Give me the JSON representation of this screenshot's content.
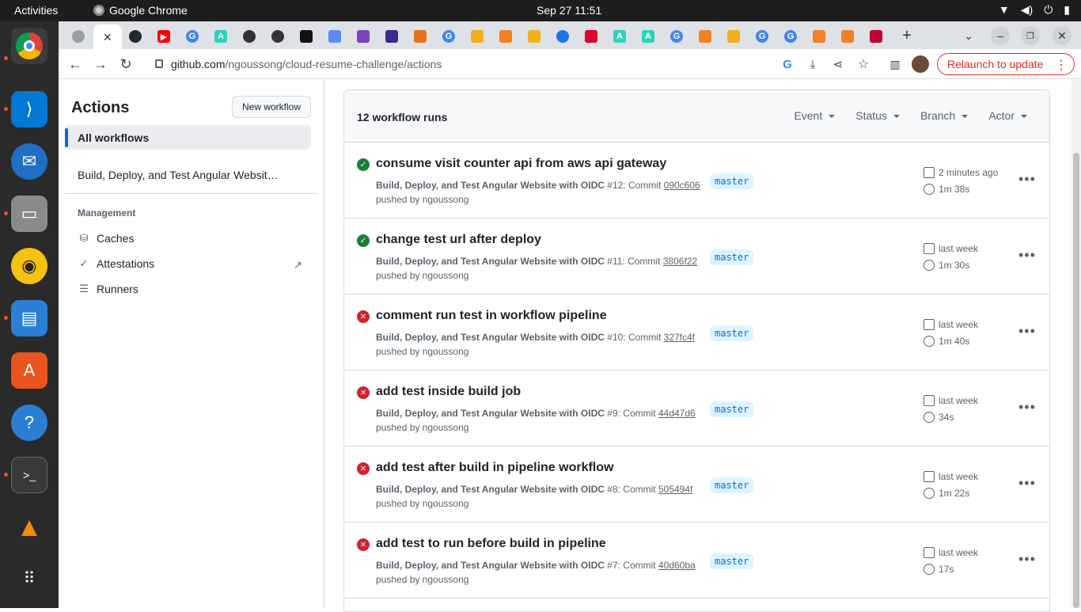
{
  "topbar": {
    "activities": "Activities",
    "app": "Google Chrome",
    "clock": "Sep 27  11:51"
  },
  "dock": [
    "chrome",
    "vscode",
    "thunderbird",
    "files",
    "rhythmbox",
    "writer",
    "app-center",
    "help",
    "terminal",
    "vlc",
    "app-grid"
  ],
  "browser": {
    "url_host": "github.com",
    "url_path": "/ngoussong/cloud-resume-challenge/actions",
    "relaunch": "Relaunch to update"
  },
  "sidebar": {
    "title": "Actions",
    "new_workflow": "New workflow",
    "all_workflows": "All workflows",
    "workflow": "Build, Deploy, and Test Angular Websit…",
    "management": "Management",
    "items": [
      {
        "label": "Caches",
        "icon": "database-icon"
      },
      {
        "label": "Attestations",
        "icon": "verified-icon"
      },
      {
        "label": "Runners",
        "icon": "server-icon"
      }
    ]
  },
  "runs": {
    "count": "12 workflow runs",
    "filters": [
      "Event",
      "Status",
      "Branch",
      "Actor"
    ],
    "list": [
      {
        "status": "success",
        "title": "consume visit counter api from aws api gateway",
        "workflow": "Build, Deploy, and Test Angular Website with OIDC",
        "num": "#12: Commit",
        "sha": "090c606",
        "by": "pushed by ngoussong",
        "branch": "master",
        "when": "2 minutes ago",
        "duration": "1m 38s"
      },
      {
        "status": "success",
        "title": "change test url after deploy",
        "workflow": "Build, Deploy, and Test Angular Website with OIDC",
        "num": "#11: Commit",
        "sha": "3806f22",
        "by": "pushed by ngoussong",
        "branch": "master",
        "when": "last week",
        "duration": "1m 30s"
      },
      {
        "status": "failure",
        "title": "comment run test in workflow pipeline",
        "workflow": "Build, Deploy, and Test Angular Website with OIDC",
        "num": "#10: Commit",
        "sha": "327fc4f",
        "by": "pushed by ngoussong",
        "branch": "master",
        "when": "last week",
        "duration": "1m 40s"
      },
      {
        "status": "failure",
        "title": "add test inside build job",
        "workflow": "Build, Deploy, and Test Angular Website with OIDC",
        "num": "#9: Commit",
        "sha": "44d47d6",
        "by": "pushed by ngoussong",
        "branch": "master",
        "when": "last week",
        "duration": "34s"
      },
      {
        "status": "failure",
        "title": "add test after build in pipeline workflow",
        "workflow": "Build, Deploy, and Test Angular Website with OIDC",
        "num": "#8: Commit",
        "sha": "505494f",
        "by": "pushed by ngoussong",
        "branch": "master",
        "when": "last week",
        "duration": "1m 22s"
      },
      {
        "status": "failure",
        "title": "add test to run before build in pipeline",
        "workflow": "Build, Deploy, and Test Angular Website with OIDC",
        "num": "#7: Commit",
        "sha": "40d60ba",
        "by": "pushed by ngoussong",
        "branch": "master",
        "when": "last week",
        "duration": "17s"
      }
    ]
  },
  "colors": {
    "success": "#1a7f37",
    "failure": "#cf222e",
    "accent": "#0969da"
  }
}
